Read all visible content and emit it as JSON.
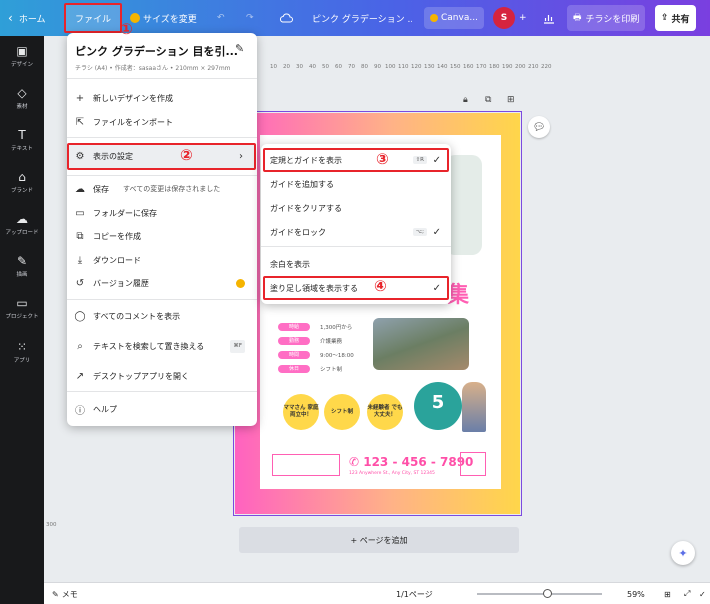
{
  "topbar": {
    "home": "ホーム",
    "file": "ファイル",
    "resize": "サイズを変更",
    "doc_title": "ピンク グラデーション ...",
    "canva_pro": "Canva...",
    "avatar": "S",
    "print": "チラシを印刷",
    "share": "共有"
  },
  "annotations": {
    "n1": "①",
    "n2": "②",
    "n3": "③",
    "n4": "④"
  },
  "rail": [
    {
      "label": "デザイン",
      "icon": "layout-icon"
    },
    {
      "label": "素材",
      "icon": "elements-icon"
    },
    {
      "label": "テキスト",
      "icon": "text-icon"
    },
    {
      "label": "ブランド",
      "icon": "brand-icon"
    },
    {
      "label": "アップロード",
      "icon": "upload-icon"
    },
    {
      "label": "描画",
      "icon": "draw-icon"
    },
    {
      "label": "プロジェクト",
      "icon": "folder-icon"
    },
    {
      "label": "アプリ",
      "icon": "apps-icon"
    }
  ],
  "ruler": {
    "h": [
      "10",
      "20",
      "30",
      "40",
      "50",
      "60",
      "70",
      "80",
      "90",
      "100",
      "110",
      "120",
      "130",
      "140",
      "150",
      "160",
      "170",
      "180",
      "190",
      "200",
      "210",
      "220"
    ],
    "v": [
      "300"
    ]
  },
  "file_menu": {
    "title": "ピンク グラデーション 目を引...",
    "subtitle": "チラシ (A4) • 作成者：sasaaさん • 210mm × 297mm",
    "items": [
      {
        "label": "新しいデザインを作成",
        "icon": "plus-icon"
      },
      {
        "label": "ファイルをインポート",
        "icon": "import-icon"
      },
      {
        "label": "表示の設定",
        "icon": "gear-icon"
      },
      {
        "label": "保存",
        "note": "すべての変更は保存されました",
        "icon": "cloud-icon"
      },
      {
        "label": "フォルダーに保存",
        "icon": "folder-icon"
      },
      {
        "label": "コピーを作成",
        "icon": "copy-icon"
      },
      {
        "label": "ダウンロード",
        "icon": "download-icon"
      },
      {
        "label": "バージョン履歴",
        "icon": "history-icon"
      },
      {
        "label": "すべてのコメントを表示",
        "icon": "comment-icon"
      },
      {
        "label": "テキストを検索して置き換える",
        "kbd": "⌘F",
        "icon": "search-icon"
      },
      {
        "label": "デスクトップアプリを開く",
        "icon": "external-icon"
      },
      {
        "label": "ヘルプ",
        "icon": "help-icon"
      }
    ]
  },
  "view_menu": {
    "items": [
      {
        "label": "定規とガイドを表示",
        "kbd": "⇧R",
        "checked": true
      },
      {
        "label": "ガイドを追加する"
      },
      {
        "label": "ガイドをクリアする"
      },
      {
        "label": "ガイドをロック",
        "kbd": "⌥;",
        "checked": true
      },
      {
        "label": "余白を表示"
      },
      {
        "label": "塗り足し領域を表示する",
        "checked": true
      }
    ]
  },
  "poster": {
    "recruit": "集",
    "info": [
      {
        "tag": "時給",
        "val": "1,300円から"
      },
      {
        "tag": "勤務",
        "val": "介護業務"
      },
      {
        "tag": "時間",
        "val": "9:00〜18:00"
      },
      {
        "tag": "休日",
        "val": "シフト制"
      }
    ],
    "bubbles": [
      "ママさん 家庭 両立中！",
      "シフト制",
      "未経験者 でも 大丈夫！"
    ],
    "salary": "5",
    "phone": "123 - 456 - 7890",
    "addr": "123 Anywhere St., Any City, ST 12345"
  },
  "add_page": "+ ページを追加",
  "bottombar": {
    "memo": "メモ",
    "pages": "1/1ページ",
    "zoom": "59%",
    "zoom_fraction": 0.55
  },
  "colors": {
    "accent_red": "#e8242b",
    "topbar_start": "#2f9fd8",
    "topbar_end": "#7a3fe0",
    "poster_pink": "#ff62c0",
    "poster_yellow": "#ffd64a"
  }
}
